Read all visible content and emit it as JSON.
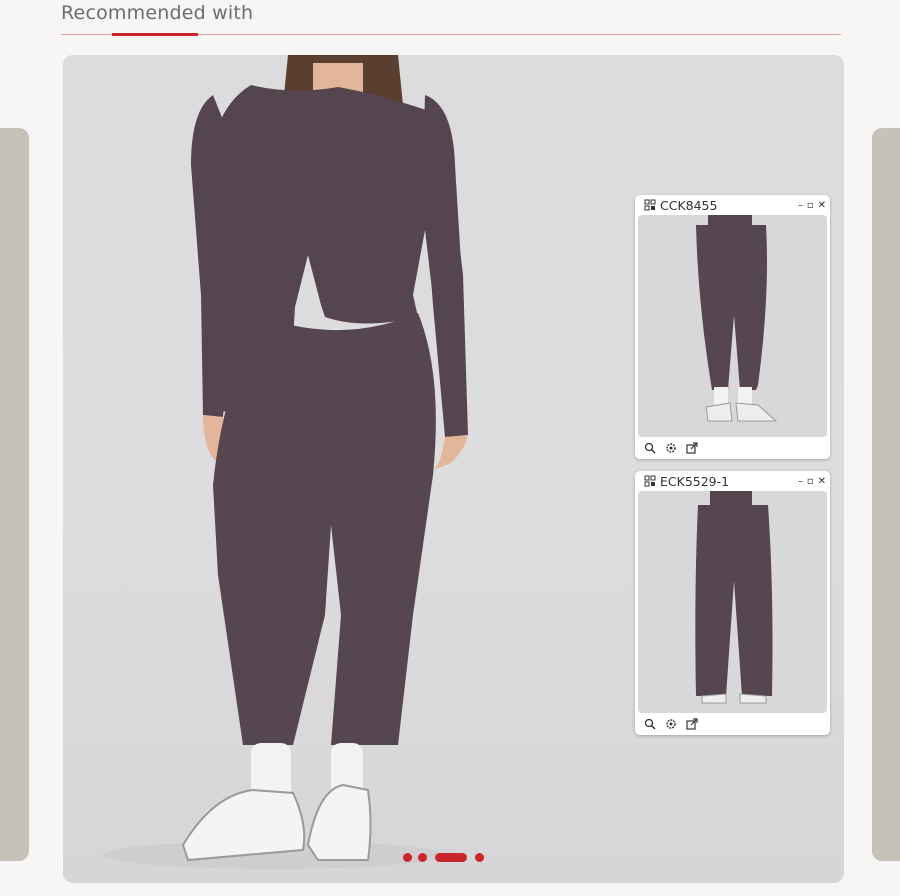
{
  "section": {
    "title": "Recommended with"
  },
  "carousel": {
    "slide_count": 4,
    "active_index": 2
  },
  "mini_windows": [
    {
      "code": "CCK8455",
      "window_controls": [
        "minimize-icon",
        "maximize-icon",
        "close-icon"
      ],
      "tools": [
        "zoom-icon",
        "settings-icon",
        "share-icon"
      ]
    },
    {
      "code": "ECK5529-1",
      "window_controls": [
        "minimize-icon",
        "maximize-icon",
        "close-icon"
      ],
      "tools": [
        "zoom-icon",
        "settings-icon",
        "share-icon"
      ]
    }
  ],
  "colors": {
    "accent": "#c9252b",
    "garment": "#56464f",
    "background": "#f7f6f5"
  }
}
